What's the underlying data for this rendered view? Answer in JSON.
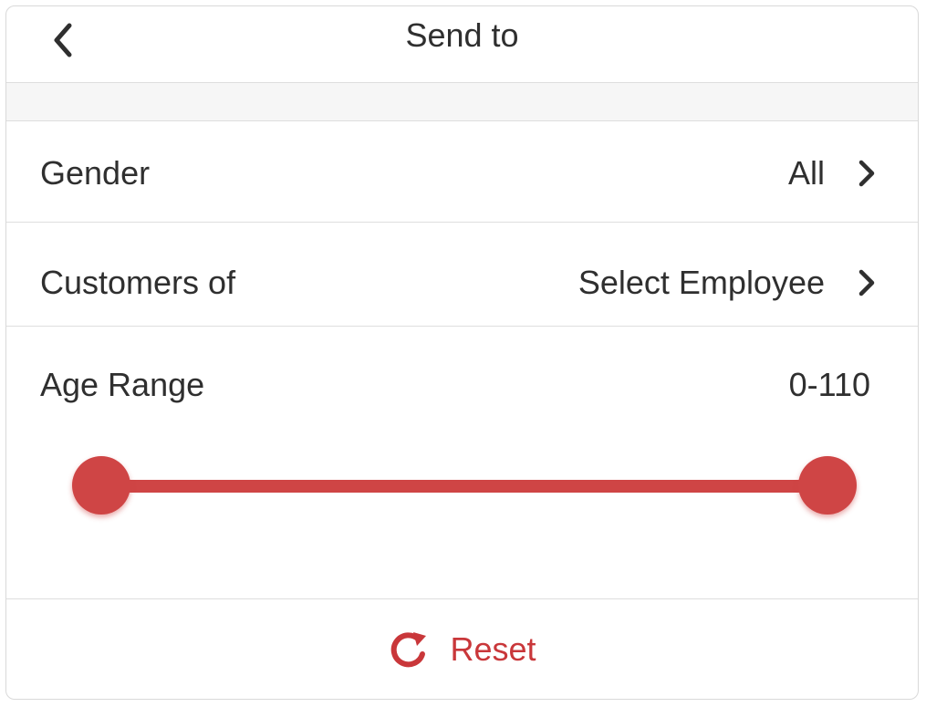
{
  "header": {
    "title": "Send to",
    "back_icon": "chevron-left-icon"
  },
  "rows": {
    "gender": {
      "label": "Gender",
      "value": "All",
      "icon": "chevron-right-icon"
    },
    "customers": {
      "label": "Customers of",
      "value": "Select Employee",
      "icon": "chevron-right-icon"
    },
    "age": {
      "label": "Age Range",
      "value": "0-110"
    }
  },
  "slider": {
    "min": 0,
    "max": 110,
    "selected_min": 0,
    "selected_max": 110
  },
  "footer": {
    "reset_label": "Reset",
    "reset_icon": "redo-icon"
  },
  "colors": {
    "accent": "#cf4545",
    "text": "#2f2f2f",
    "divider": "#dedede",
    "spacer": "#f6f6f6"
  }
}
